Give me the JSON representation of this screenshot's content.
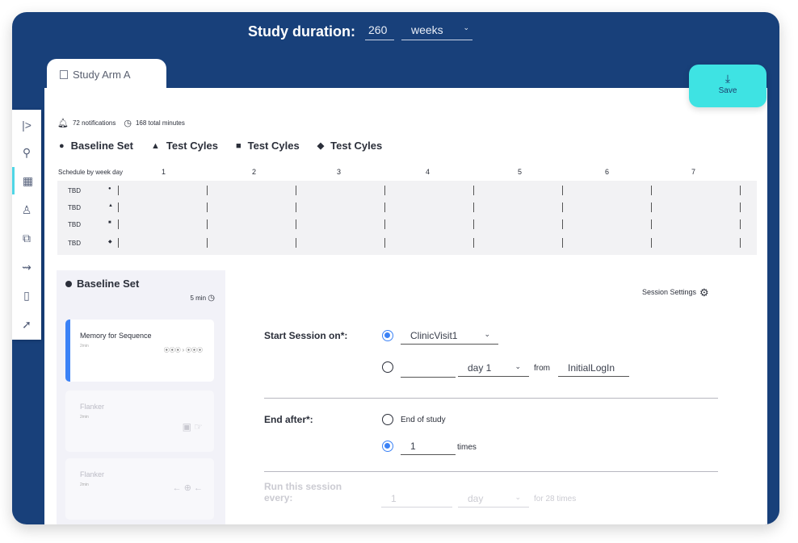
{
  "header": {
    "duration_label": "Study duration:",
    "duration_value": "260",
    "duration_unit": "weeks"
  },
  "tab": {
    "label": "Study Arm A",
    "icon": "document-icon"
  },
  "save_button": {
    "label": "Save",
    "icon": "download-icon"
  },
  "sidebar": {
    "items": [
      {
        "icon": "collapse-icon",
        "glyph": "|>"
      },
      {
        "icon": "bike-icon",
        "glyph": "⚲"
      },
      {
        "icon": "calendar-icon",
        "glyph": "▦"
      },
      {
        "icon": "user-settings-icon",
        "glyph": "♙"
      },
      {
        "icon": "layers-icon",
        "glyph": "⧉"
      },
      {
        "icon": "flow-icon",
        "glyph": "⇝"
      },
      {
        "icon": "phone-icon",
        "glyph": "▯"
      },
      {
        "icon": "rocket-icon",
        "glyph": "➚"
      }
    ]
  },
  "stats": {
    "notifications": "72 notifications",
    "total_minutes": "168 total minutes"
  },
  "legend": [
    {
      "symbol": "●",
      "label": "Baseline Set"
    },
    {
      "symbol": "▲",
      "label": "Test Cyles"
    },
    {
      "symbol": "■",
      "label": "Test Cyles"
    },
    {
      "symbol": "◆",
      "label": "Test Cyles"
    }
  ],
  "schedule": {
    "header_label": "Schedule by week day",
    "days": [
      "1",
      "2",
      "3",
      "4",
      "5",
      "6",
      "7"
    ],
    "rows": [
      {
        "label": "TBD",
        "symbol": "●"
      },
      {
        "label": "TBD",
        "symbol": "▲"
      },
      {
        "label": "TBD",
        "symbol": "■"
      },
      {
        "label": "TBD",
        "symbol": "◆"
      }
    ]
  },
  "session_panel": {
    "title": "Baseline Set",
    "duration": "5 min",
    "cards": [
      {
        "title": "Memory for Sequence",
        "sub": "2min",
        "art": "⦿⦿⦿ › ⦿⦿⦿"
      },
      {
        "title": "Flanker",
        "sub": "2min",
        "art": "▣ ☞"
      },
      {
        "title": "Flanker",
        "sub": "2min",
        "art": "← ⊕ ←"
      }
    ]
  },
  "settings": {
    "label": "Session Settings"
  },
  "form": {
    "start_label": "Start Session on*:",
    "start_option1": "ClinicVisit1",
    "start_option2_value": "",
    "start_option2_day": "day 1",
    "from_label": "from",
    "from_value": "InitialLogIn",
    "end_label": "End after*:",
    "end_option1": "End of study",
    "end_option2_value": "1",
    "end_option2_unit": "times",
    "run_label_line1": "Run this session",
    "run_label_line2": "every:",
    "run_value": "1",
    "run_unit": "day",
    "run_suffix": "for 28 times"
  }
}
